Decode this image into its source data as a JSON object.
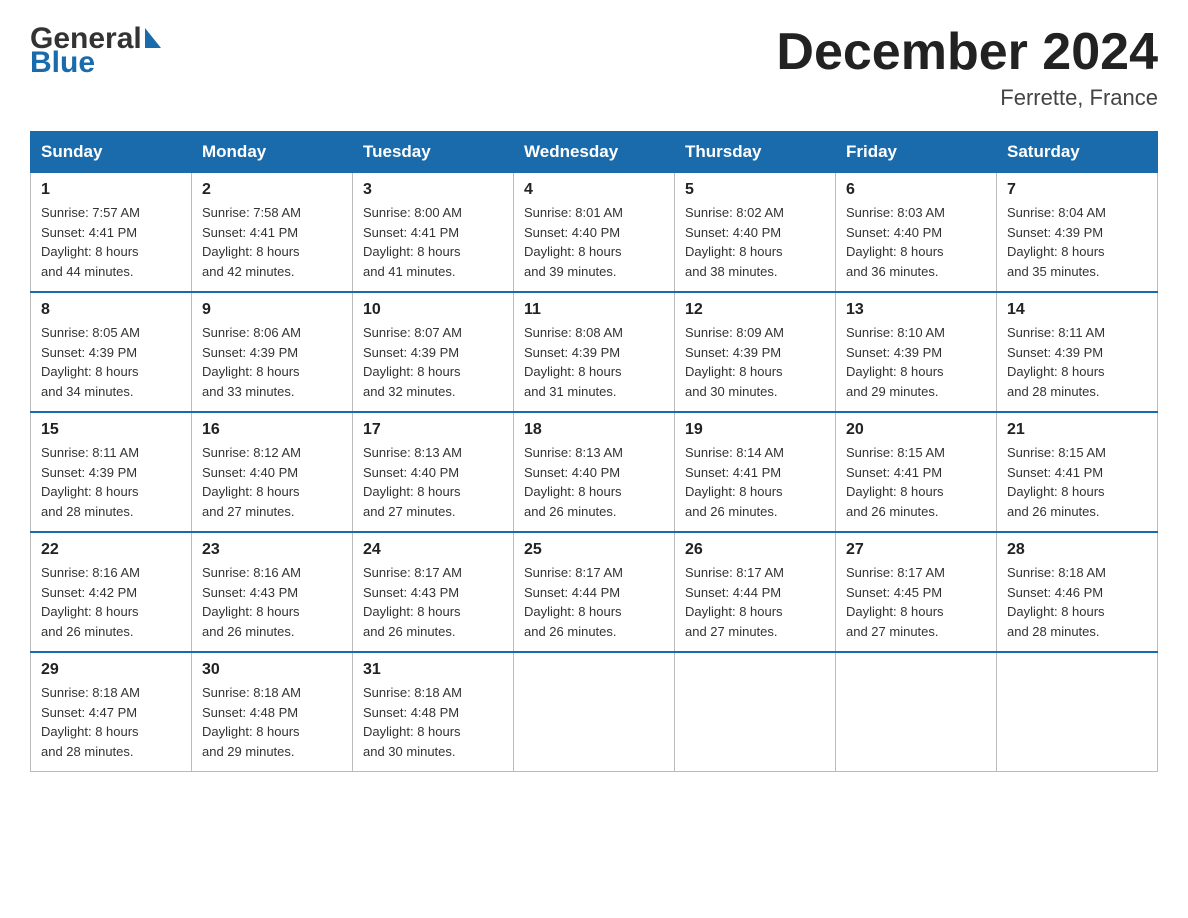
{
  "header": {
    "logo_general": "General",
    "logo_blue": "Blue",
    "month_title": "December 2024",
    "location": "Ferrette, France"
  },
  "days_of_week": [
    "Sunday",
    "Monday",
    "Tuesday",
    "Wednesday",
    "Thursday",
    "Friday",
    "Saturday"
  ],
  "weeks": [
    [
      {
        "day": "1",
        "sunrise": "7:57 AM",
        "sunset": "4:41 PM",
        "daylight": "8 hours and 44 minutes."
      },
      {
        "day": "2",
        "sunrise": "7:58 AM",
        "sunset": "4:41 PM",
        "daylight": "8 hours and 42 minutes."
      },
      {
        "day": "3",
        "sunrise": "8:00 AM",
        "sunset": "4:41 PM",
        "daylight": "8 hours and 41 minutes."
      },
      {
        "day": "4",
        "sunrise": "8:01 AM",
        "sunset": "4:40 PM",
        "daylight": "8 hours and 39 minutes."
      },
      {
        "day": "5",
        "sunrise": "8:02 AM",
        "sunset": "4:40 PM",
        "daylight": "8 hours and 38 minutes."
      },
      {
        "day": "6",
        "sunrise": "8:03 AM",
        "sunset": "4:40 PM",
        "daylight": "8 hours and 36 minutes."
      },
      {
        "day": "7",
        "sunrise": "8:04 AM",
        "sunset": "4:39 PM",
        "daylight": "8 hours and 35 minutes."
      }
    ],
    [
      {
        "day": "8",
        "sunrise": "8:05 AM",
        "sunset": "4:39 PM",
        "daylight": "8 hours and 34 minutes."
      },
      {
        "day": "9",
        "sunrise": "8:06 AM",
        "sunset": "4:39 PM",
        "daylight": "8 hours and 33 minutes."
      },
      {
        "day": "10",
        "sunrise": "8:07 AM",
        "sunset": "4:39 PM",
        "daylight": "8 hours and 32 minutes."
      },
      {
        "day": "11",
        "sunrise": "8:08 AM",
        "sunset": "4:39 PM",
        "daylight": "8 hours and 31 minutes."
      },
      {
        "day": "12",
        "sunrise": "8:09 AM",
        "sunset": "4:39 PM",
        "daylight": "8 hours and 30 minutes."
      },
      {
        "day": "13",
        "sunrise": "8:10 AM",
        "sunset": "4:39 PM",
        "daylight": "8 hours and 29 minutes."
      },
      {
        "day": "14",
        "sunrise": "8:11 AM",
        "sunset": "4:39 PM",
        "daylight": "8 hours and 28 minutes."
      }
    ],
    [
      {
        "day": "15",
        "sunrise": "8:11 AM",
        "sunset": "4:39 PM",
        "daylight": "8 hours and 28 minutes."
      },
      {
        "day": "16",
        "sunrise": "8:12 AM",
        "sunset": "4:40 PM",
        "daylight": "8 hours and 27 minutes."
      },
      {
        "day": "17",
        "sunrise": "8:13 AM",
        "sunset": "4:40 PM",
        "daylight": "8 hours and 27 minutes."
      },
      {
        "day": "18",
        "sunrise": "8:13 AM",
        "sunset": "4:40 PM",
        "daylight": "8 hours and 26 minutes."
      },
      {
        "day": "19",
        "sunrise": "8:14 AM",
        "sunset": "4:41 PM",
        "daylight": "8 hours and 26 minutes."
      },
      {
        "day": "20",
        "sunrise": "8:15 AM",
        "sunset": "4:41 PM",
        "daylight": "8 hours and 26 minutes."
      },
      {
        "day": "21",
        "sunrise": "8:15 AM",
        "sunset": "4:41 PM",
        "daylight": "8 hours and 26 minutes."
      }
    ],
    [
      {
        "day": "22",
        "sunrise": "8:16 AM",
        "sunset": "4:42 PM",
        "daylight": "8 hours and 26 minutes."
      },
      {
        "day": "23",
        "sunrise": "8:16 AM",
        "sunset": "4:43 PM",
        "daylight": "8 hours and 26 minutes."
      },
      {
        "day": "24",
        "sunrise": "8:17 AM",
        "sunset": "4:43 PM",
        "daylight": "8 hours and 26 minutes."
      },
      {
        "day": "25",
        "sunrise": "8:17 AM",
        "sunset": "4:44 PM",
        "daylight": "8 hours and 26 minutes."
      },
      {
        "day": "26",
        "sunrise": "8:17 AM",
        "sunset": "4:44 PM",
        "daylight": "8 hours and 27 minutes."
      },
      {
        "day": "27",
        "sunrise": "8:17 AM",
        "sunset": "4:45 PM",
        "daylight": "8 hours and 27 minutes."
      },
      {
        "day": "28",
        "sunrise": "8:18 AM",
        "sunset": "4:46 PM",
        "daylight": "8 hours and 28 minutes."
      }
    ],
    [
      {
        "day": "29",
        "sunrise": "8:18 AM",
        "sunset": "4:47 PM",
        "daylight": "8 hours and 28 minutes."
      },
      {
        "day": "30",
        "sunrise": "8:18 AM",
        "sunset": "4:48 PM",
        "daylight": "8 hours and 29 minutes."
      },
      {
        "day": "31",
        "sunrise": "8:18 AM",
        "sunset": "4:48 PM",
        "daylight": "8 hours and 30 minutes."
      },
      null,
      null,
      null,
      null
    ]
  ],
  "labels": {
    "sunrise": "Sunrise:",
    "sunset": "Sunset:",
    "daylight": "Daylight:"
  }
}
